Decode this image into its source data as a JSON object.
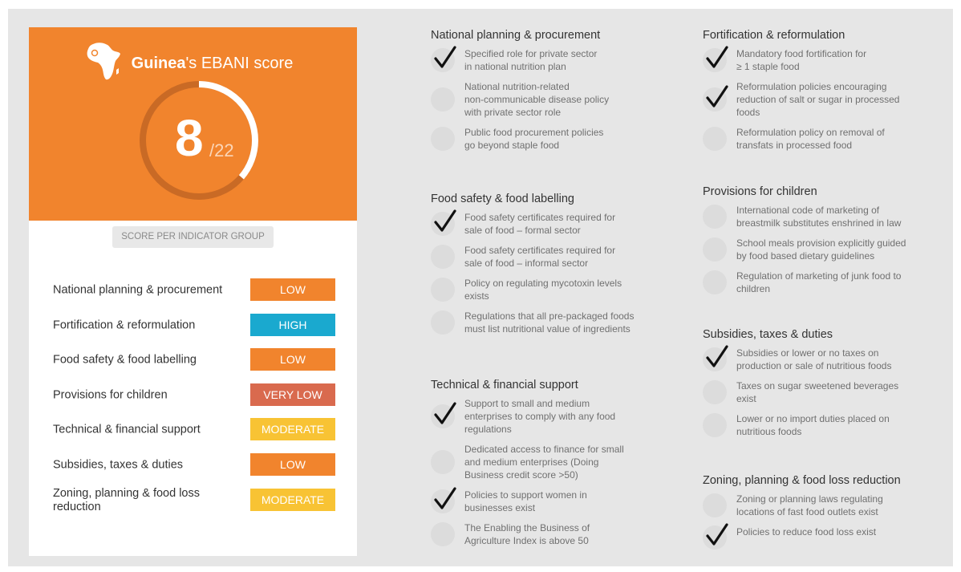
{
  "colors": {
    "background": "#e6e6e6",
    "hero": "#f1842d",
    "low": "#f1842d",
    "high": "#1aa9cf",
    "very_low": "#d96a4e",
    "moderate": "#f8c334",
    "achieved_dot": "#dcdcdc",
    "check": "#111111"
  },
  "scorecard": {
    "country": "Guinea",
    "title_suffix": "'s EBANI score",
    "score": "8",
    "total": "/22",
    "score_value": 8,
    "score_max": 22,
    "group_heading": "SCORE PER INDICATOR GROUP",
    "groups": [
      {
        "label": "National planning & procurement",
        "rating": "LOW",
        "color": "#f1842d"
      },
      {
        "label": "Fortification & reformulation",
        "rating": "HIGH",
        "color": "#1aa9cf"
      },
      {
        "label": "Food safety & food labelling",
        "rating": "LOW",
        "color": "#f1842d"
      },
      {
        "label": "Provisions for children",
        "rating": "VERY LOW",
        "color": "#d96a4e"
      },
      {
        "label": "Technical & financial support",
        "rating": "MODERATE",
        "color": "#f8c334"
      },
      {
        "label": "Subsidies, taxes & duties",
        "rating": "LOW",
        "color": "#f1842d"
      },
      {
        "label": "Zoning, planning & food loss reduction",
        "rating": "MODERATE",
        "color": "#f8c334"
      }
    ]
  },
  "sections": [
    {
      "title": "National planning & procurement",
      "items": [
        {
          "text": "Specified role for private sector\nin national nutrition plan",
          "achieved": true
        },
        {
          "text": "National nutrition-related\nnon-communicable disease policy\nwith private sector role",
          "achieved": false
        },
        {
          "text": "Public food procurement policies\ngo beyond staple food",
          "achieved": false
        }
      ]
    },
    {
      "title": "Food safety & food labelling",
      "items": [
        {
          "text": "Food safety certificates required for\nsale of food – formal sector",
          "achieved": true
        },
        {
          "text": "Food safety certificates required for\nsale of food – informal sector",
          "achieved": false
        },
        {
          "text": "Policy on regulating mycotoxin levels\nexists",
          "achieved": false
        },
        {
          "text": "Regulations that all pre-packaged foods\nmust list nutritional value of ingredients",
          "achieved": false
        }
      ]
    },
    {
      "title": "Technical & financial support",
      "items": [
        {
          "text": "Support to small and medium\nenterprises to comply with any food\nregulations",
          "achieved": true
        },
        {
          "text": "Dedicated access to finance for small\nand medium enterprises (Doing\nBusiness credit score >50)",
          "achieved": false
        },
        {
          "text": "Policies to support women in\nbusinesses exist",
          "achieved": true
        },
        {
          "text": "The Enabling the Business of\nAgriculture Index is above 50",
          "achieved": false
        }
      ]
    },
    {
      "title": "Fortification & reformulation",
      "items": [
        {
          "text": "Mandatory food fortification for\n≥ 1 staple food",
          "achieved": true
        },
        {
          "text": "Reformulation policies encouraging\nreduction of salt or sugar in processed\nfoods",
          "achieved": true
        },
        {
          "text": "Reformulation policy on removal of\ntransfats in processed food",
          "achieved": false
        }
      ]
    },
    {
      "title": "Provisions for children",
      "items": [
        {
          "text": "International code of marketing of\nbreastmilk substitutes enshrined in law",
          "achieved": false
        },
        {
          "text": "School meals provision explicitly guided\nby food based dietary guidelines",
          "achieved": false
        },
        {
          "text": "Regulation of marketing of junk food to\nchildren",
          "achieved": false
        }
      ]
    },
    {
      "title": "Subsidies, taxes & duties",
      "items": [
        {
          "text": "Subsidies or lower or no taxes on\nproduction or sale of nutritious foods",
          "achieved": true
        },
        {
          "text": "Taxes on sugar sweetened beverages\nexist",
          "achieved": false
        },
        {
          "text": "Lower or no import duties placed on\nnutritious foods",
          "achieved": false
        }
      ]
    },
    {
      "title": "Zoning, planning & food loss reduction",
      "items": [
        {
          "text": "Zoning or planning laws regulating\nlocations of fast food outlets exist",
          "achieved": false
        },
        {
          "text": "Policies to reduce food loss exist",
          "achieved": true
        }
      ]
    }
  ]
}
